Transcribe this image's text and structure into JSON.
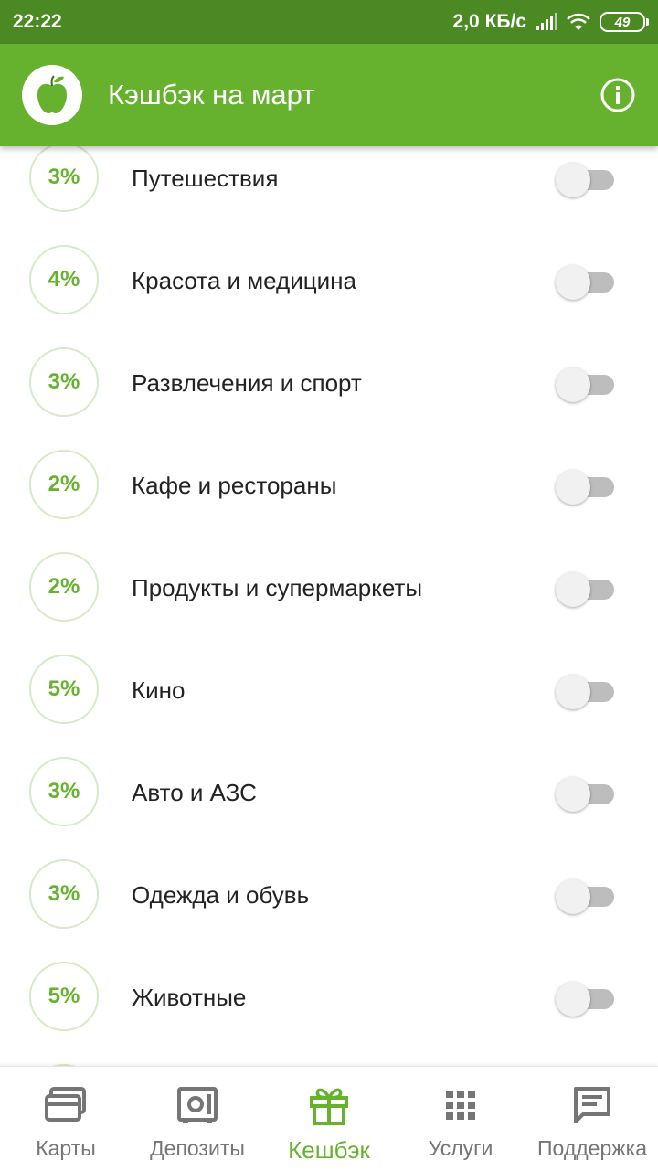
{
  "status_bar": {
    "time": "22:22",
    "network_speed": "2,0 КБ/с",
    "battery": "49",
    "icons": [
      "signal-icon",
      "wifi-icon",
      "battery-icon"
    ]
  },
  "header": {
    "title": "Кэшбэк на март",
    "logo_icon": "apple-icon",
    "info_icon": "info-icon"
  },
  "colors": {
    "accent": "#66b22e",
    "status_bar": "#4b8a22",
    "toggle_off_track": "#bdbdbd"
  },
  "categories": [
    {
      "percent": "3%",
      "label": "Путешествия",
      "enabled": false
    },
    {
      "percent": "4%",
      "label": "Красота и медицина",
      "enabled": false
    },
    {
      "percent": "3%",
      "label": "Развлечения и спорт",
      "enabled": false
    },
    {
      "percent": "2%",
      "label": "Кафе и рестораны",
      "enabled": false
    },
    {
      "percent": "2%",
      "label": "Продукты и супермаркеты",
      "enabled": false
    },
    {
      "percent": "5%",
      "label": "Кино",
      "enabled": false
    },
    {
      "percent": "3%",
      "label": "Авто и АЗС",
      "enabled": false
    },
    {
      "percent": "3%",
      "label": "Одежда и обувь",
      "enabled": false
    },
    {
      "percent": "5%",
      "label": "Животные",
      "enabled": false
    },
    {
      "percent": "",
      "label": "",
      "enabled": false
    }
  ],
  "bottom_nav": [
    {
      "label": "Карты",
      "icon": "cards-icon",
      "active": false
    },
    {
      "label": "Депозиты",
      "icon": "safe-icon",
      "active": false
    },
    {
      "label": "Кешбэк",
      "icon": "gift-icon",
      "active": true
    },
    {
      "label": "Услуги",
      "icon": "grid-icon",
      "active": false
    },
    {
      "label": "Поддержка",
      "icon": "chat-icon",
      "active": false
    }
  ]
}
